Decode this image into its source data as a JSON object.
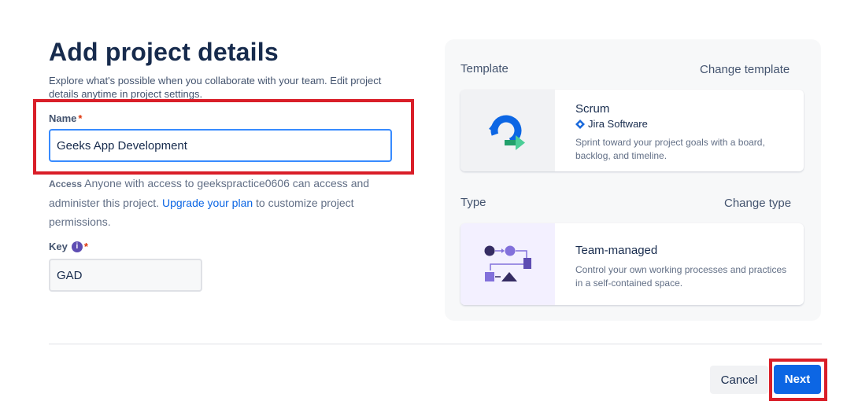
{
  "header": {
    "title": "Add project details",
    "subtitle": "Explore what's possible when you collaborate with your team. Edit project details anytime in project settings."
  },
  "form": {
    "name_label": "Name",
    "required_mark": "*",
    "name_value": "Geeks App Development",
    "access_label": "Access",
    "access_text_1": "Anyone with access to geekspractice0606 can access and administer this project.",
    "access_link": "Upgrade your plan",
    "access_text_2": "to customize project permissions.",
    "key_label": "Key",
    "key_info": "i",
    "key_value": "GAD"
  },
  "template": {
    "section_label": "Template",
    "change_label": "Change template",
    "card_title": "Scrum",
    "product_name": "Jira Software",
    "description": "Sprint toward your project goals with a board, backlog, and timeline."
  },
  "type": {
    "section_label": "Type",
    "change_label": "Change type",
    "card_title": "Team-managed",
    "description": "Control your own working processes and practices in a self-contained space."
  },
  "footer": {
    "cancel_label": "Cancel",
    "next_label": "Next"
  },
  "icons": {
    "scrum": "scrum-cycle-icon",
    "jira": "jira-diamond-icon",
    "team": "workflow-diagram-icon",
    "info": "info-icon"
  },
  "colors": {
    "primary": "#0c66e4",
    "highlight": "#d91e28",
    "text": "#172b4d",
    "muted": "#626f86",
    "focus_border": "#388bff"
  }
}
